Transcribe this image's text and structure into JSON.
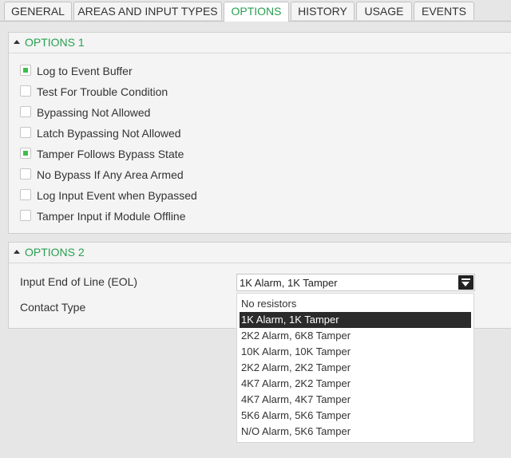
{
  "tabs": [
    {
      "label": "GENERAL"
    },
    {
      "label": "AREAS AND INPUT TYPES"
    },
    {
      "label": "OPTIONS"
    },
    {
      "label": "HISTORY"
    },
    {
      "label": "USAGE"
    },
    {
      "label": "EVENTS"
    }
  ],
  "active_tab": "OPTIONS",
  "options1": {
    "title": "OPTIONS 1",
    "items": [
      {
        "label": "Log to Event Buffer",
        "checked": true
      },
      {
        "label": "Test For Trouble Condition",
        "checked": false
      },
      {
        "label": "Bypassing Not Allowed",
        "checked": false
      },
      {
        "label": "Latch Bypassing Not Allowed",
        "checked": false
      },
      {
        "label": "Tamper Follows Bypass State",
        "checked": true
      },
      {
        "label": "No Bypass If Any Area Armed",
        "checked": false
      },
      {
        "label": "Log Input Event when Bypassed",
        "checked": false
      },
      {
        "label": "Tamper Input if Module Offline",
        "checked": false
      }
    ]
  },
  "options2": {
    "title": "OPTIONS 2",
    "eol_label": "Input End of Line (EOL)",
    "contact_label": "Contact Type",
    "eol_value": "1K Alarm, 1K Tamper",
    "eol_options": [
      "No resistors",
      "1K Alarm, 1K Tamper",
      "2K2 Alarm, 6K8 Tamper",
      "10K Alarm, 10K Tamper",
      "2K2 Alarm, 2K2 Tamper",
      "4K7 Alarm, 2K2 Tamper",
      "4K7 Alarm, 4K7 Tamper",
      "5K6 Alarm, 5K6 Tamper",
      "N/O Alarm, 5K6 Tamper"
    ]
  },
  "colors": {
    "accent": "#27a050",
    "checkbox_on": "#3bbf4a",
    "selected_bg": "#2b2b2b"
  }
}
